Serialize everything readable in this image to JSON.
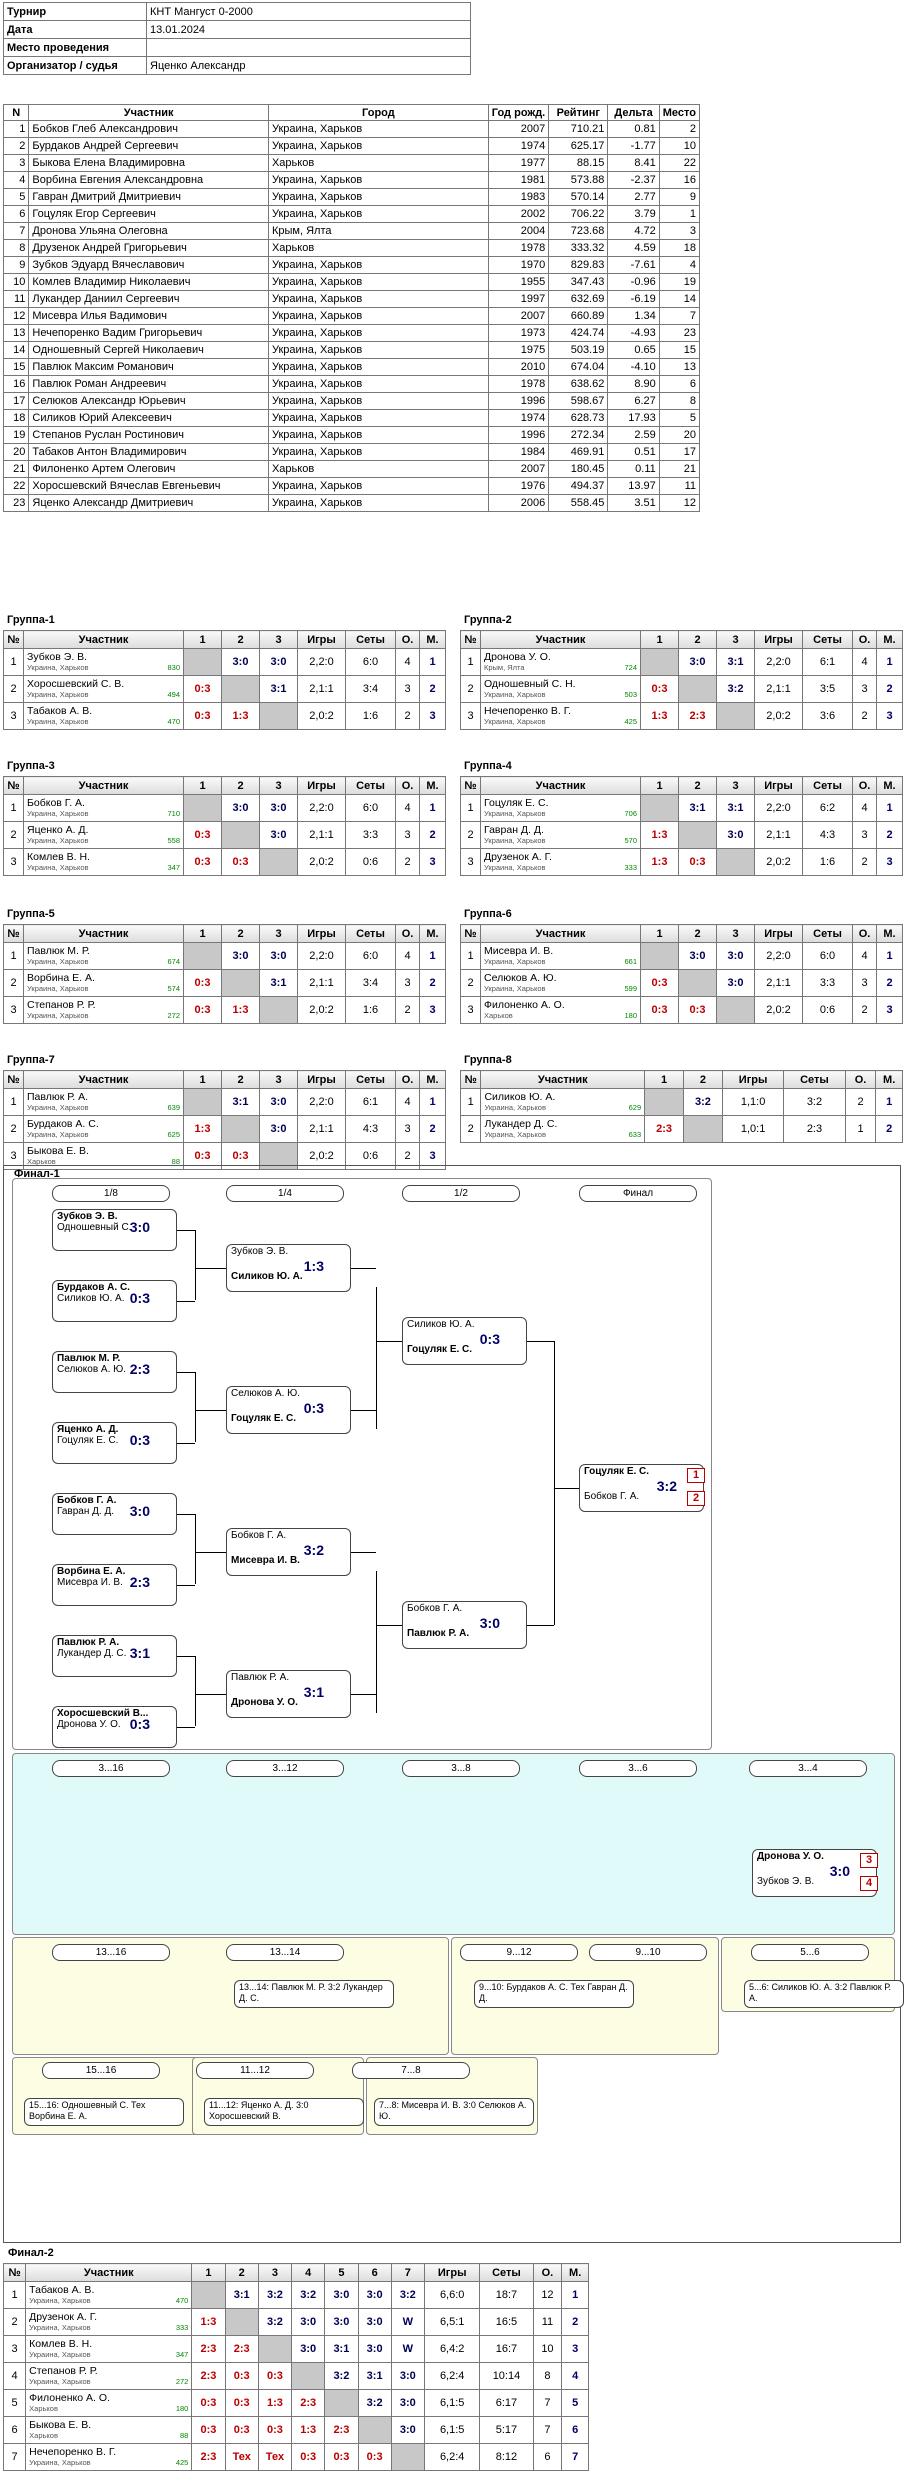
{
  "info": {
    "rows": [
      [
        "Турнир",
        "КНТ Мангуст 0-2000"
      ],
      [
        "Дата",
        "13.01.2024"
      ],
      [
        "Место проведения",
        ""
      ],
      [
        "Организатор / судья",
        "Яценко Александр"
      ]
    ]
  },
  "main": {
    "headers": [
      "N",
      "Участник",
      "Город",
      "Год рожд.",
      "Рейтинг",
      "Дельта",
      "Место"
    ],
    "rows": [
      [
        "1",
        "Бобков Глеб Александрович",
        "Украина, Харьков",
        "2007",
        "710.21",
        "0.81",
        "2"
      ],
      [
        "2",
        "Бурдаков Андрей Сергеевич",
        "Украина, Харьков",
        "1974",
        "625.17",
        "-1.77",
        "10"
      ],
      [
        "3",
        "Быкова Елена Владимировна",
        "Харьков",
        "1977",
        "88.15",
        "8.41",
        "22"
      ],
      [
        "4",
        "Ворбина Евгения Александровна",
        "Украина, Харьков",
        "1981",
        "573.88",
        "-2.37",
        "16"
      ],
      [
        "5",
        "Гавран Дмитрий Дмитриевич",
        "Украина, Харьков",
        "1983",
        "570.14",
        "2.77",
        "9"
      ],
      [
        "6",
        "Гоцуляк Егор Сергеевич",
        "Украина, Харьков",
        "2002",
        "706.22",
        "3.79",
        "1"
      ],
      [
        "7",
        "Дронова Ульяна Олеговна",
        "Крым, Ялта",
        "2004",
        "723.68",
        "4.72",
        "3"
      ],
      [
        "8",
        "Друзенок Андрей Григорьевич",
        "Харьков",
        "1978",
        "333.32",
        "4.59",
        "18"
      ],
      [
        "9",
        "Зубков Эдуард Вячеславович",
        "Украина, Харьков",
        "1970",
        "829.83",
        "-7.61",
        "4"
      ],
      [
        "10",
        "Комлев Владимир Николаевич",
        "Украина, Харьков",
        "1955",
        "347.43",
        "-0.96",
        "19"
      ],
      [
        "11",
        "Лукандер Даниил Сергеевич",
        "Украина, Харьков",
        "1997",
        "632.69",
        "-6.19",
        "14"
      ],
      [
        "12",
        "Мисевра Илья Вадимович",
        "Украина, Харьков",
        "2007",
        "660.89",
        "1.34",
        "7"
      ],
      [
        "13",
        "Нечепоренко Вадим Григорьевич",
        "Украина, Харьков",
        "1973",
        "424.74",
        "-4.93",
        "23"
      ],
      [
        "14",
        "Однoшевный Сергей Николаевич",
        "Украина, Харьков",
        "1975",
        "503.19",
        "0.65",
        "15"
      ],
      [
        "15",
        "Павлюк Максим Романович",
        "Украина, Харьков",
        "2010",
        "674.04",
        "-4.10",
        "13"
      ],
      [
        "16",
        "Павлюк Роман Андреевич",
        "Украина, Харьков",
        "1978",
        "638.62",
        "8.90",
        "6"
      ],
      [
        "17",
        "Селюков Александр Юрьевич",
        "Украина, Харьков",
        "1996",
        "598.67",
        "6.27",
        "8"
      ],
      [
        "18",
        "Силиков Юрий Алексеевич",
        "Украина, Харьков",
        "1974",
        "628.73",
        "17.93",
        "5"
      ],
      [
        "19",
        "Степанов Руслан Ростинович",
        "Украина, Харьков",
        "1996",
        "272.34",
        "2.59",
        "20"
      ],
      [
        "20",
        "Табаков Антон Владимирович",
        "Украина, Харьков",
        "1984",
        "469.91",
        "0.51",
        "17"
      ],
      [
        "21",
        "Филоненко Артем Олегович",
        "Харьков",
        "2007",
        "180.45",
        "0.11",
        "21"
      ],
      [
        "22",
        "Хоросшевский Вячеслав Евгеньевич",
        "Украина, Харьков",
        "1976",
        "494.37",
        "13.97",
        "11"
      ],
      [
        "23",
        "Яценко Александр Дмитриевич",
        "Украина, Харьков",
        "2006",
        "558.45",
        "3.51",
        "12"
      ]
    ]
  },
  "group_headers": [
    "№",
    "Участник",
    "1",
    "2",
    "3",
    "Игры",
    "Сеты",
    "О.",
    "М."
  ],
  "groups": [
    {
      "title": "Группа-1",
      "rows": [
        {
          "n": "1",
          "name": "Зубков Э. В.",
          "city": "Украина, Харьков",
          "rating": "830",
          "s": [
            "",
            "3:0",
            "3:0"
          ],
          "games": "2,2:0",
          "sets": "6:0",
          "pts": "4",
          "pl": "1"
        },
        {
          "n": "2",
          "name": "Хоросшевский С. В.",
          "city": "Украина, Харьков",
          "rating": "494",
          "s": [
            "0:3",
            "",
            "3:1"
          ],
          "games": "2,1:1",
          "sets": "3:4",
          "pts": "3",
          "pl": "2"
        },
        {
          "n": "3",
          "name": "Табаков А. В.",
          "city": "Украина, Харьков",
          "rating": "470",
          "s": [
            "0:3",
            "1:3",
            ""
          ],
          "games": "2,0:2",
          "sets": "1:6",
          "pts": "2",
          "pl": "3"
        }
      ]
    },
    {
      "title": "Группа-2",
      "rows": [
        {
          "n": "1",
          "name": "Дронова У. О.",
          "city": "Крым, Ялта",
          "rating": "724",
          "s": [
            "",
            "3:0",
            "3:1"
          ],
          "games": "2,2:0",
          "sets": "6:1",
          "pts": "4",
          "pl": "1"
        },
        {
          "n": "2",
          "name": "Однoшевный С. Н.",
          "city": "Украина, Харьков",
          "rating": "503",
          "s": [
            "0:3",
            "",
            "3:2"
          ],
          "games": "2,1:1",
          "sets": "3:5",
          "pts": "3",
          "pl": "2"
        },
        {
          "n": "3",
          "name": "Нечепоренко В. Г.",
          "city": "Украина, Харьков",
          "rating": "425",
          "s": [
            "1:3",
            "2:3",
            ""
          ],
          "games": "2,0:2",
          "sets": "3:6",
          "pts": "2",
          "pl": "3"
        }
      ]
    },
    {
      "title": "Группа-3",
      "rows": [
        {
          "n": "1",
          "name": "Бобков Г. А.",
          "city": "Украина, Харьков",
          "rating": "710",
          "s": [
            "",
            "3:0",
            "3:0"
          ],
          "games": "2,2:0",
          "sets": "6:0",
          "pts": "4",
          "pl": "1"
        },
        {
          "n": "2",
          "name": "Яценко А. Д.",
          "city": "Украина, Харьков",
          "rating": "558",
          "s": [
            "0:3",
            "",
            "3:0"
          ],
          "games": "2,1:1",
          "sets": "3:3",
          "pts": "3",
          "pl": "2"
        },
        {
          "n": "3",
          "name": "Комлев В. Н.",
          "city": "Украина, Харьков",
          "rating": "347",
          "s": [
            "0:3",
            "0:3",
            ""
          ],
          "games": "2,0:2",
          "sets": "0:6",
          "pts": "2",
          "pl": "3"
        }
      ]
    },
    {
      "title": "Группа-4",
      "rows": [
        {
          "n": "1",
          "name": "Гоцуляк Е. С.",
          "city": "Украина, Харьков",
          "rating": "706",
          "s": [
            "",
            "3:1",
            "3:1"
          ],
          "games": "2,2:0",
          "sets": "6:2",
          "pts": "4",
          "pl": "1"
        },
        {
          "n": "2",
          "name": "Гавран Д. Д.",
          "city": "Украина, Харьков",
          "rating": "570",
          "s": [
            "1:3",
            "",
            "3:0"
          ],
          "games": "2,1:1",
          "sets": "4:3",
          "pts": "3",
          "pl": "2"
        },
        {
          "n": "3",
          "name": "Друзенок А. Г.",
          "city": "Украина, Харьков",
          "rating": "333",
          "s": [
            "1:3",
            "0:3",
            ""
          ],
          "games": "2,0:2",
          "sets": "1:6",
          "pts": "2",
          "pl": "3"
        }
      ]
    },
    {
      "title": "Группа-5",
      "rows": [
        {
          "n": "1",
          "name": "Павлюк М. Р.",
          "city": "Украина, Харьков",
          "rating": "674",
          "s": [
            "",
            "3:0",
            "3:0"
          ],
          "games": "2,2:0",
          "sets": "6:0",
          "pts": "4",
          "pl": "1"
        },
        {
          "n": "2",
          "name": "Ворбина Е. А.",
          "city": "Украина, Харьков",
          "rating": "574",
          "s": [
            "0:3",
            "",
            "3:1"
          ],
          "games": "2,1:1",
          "sets": "3:4",
          "pts": "3",
          "pl": "2"
        },
        {
          "n": "3",
          "name": "Степанов Р. Р.",
          "city": "Украина, Харьков",
          "rating": "272",
          "s": [
            "0:3",
            "1:3",
            ""
          ],
          "games": "2,0:2",
          "sets": "1:6",
          "pts": "2",
          "pl": "3"
        }
      ]
    },
    {
      "title": "Группа-6",
      "rows": [
        {
          "n": "1",
          "name": "Мисевра И. В.",
          "city": "Украина, Харьков",
          "rating": "661",
          "s": [
            "",
            "3:0",
            "3:0"
          ],
          "games": "2,2:0",
          "sets": "6:0",
          "pts": "4",
          "pl": "1"
        },
        {
          "n": "2",
          "name": "Селюков А. Ю.",
          "city": "Украина, Харьков",
          "rating": "599",
          "s": [
            "0:3",
            "",
            "3:0"
          ],
          "games": "2,1:1",
          "sets": "3:3",
          "pts": "3",
          "pl": "2"
        },
        {
          "n": "3",
          "name": "Филоненко А. О.",
          "city": "Харьков",
          "rating": "180",
          "s": [
            "0:3",
            "0:3",
            ""
          ],
          "games": "2,0:2",
          "sets": "0:6",
          "pts": "2",
          "pl": "3"
        }
      ]
    },
    {
      "title": "Группа-7",
      "rows": [
        {
          "n": "1",
          "name": "Павлюк Р. А.",
          "city": "Украина, Харьков",
          "rating": "639",
          "s": [
            "",
            "3:1",
            "3:0"
          ],
          "games": "2,2:0",
          "sets": "6:1",
          "pts": "4",
          "pl": "1"
        },
        {
          "n": "2",
          "name": "Бурдаков А. С.",
          "city": "Украина, Харьков",
          "rating": "625",
          "s": [
            "1:3",
            "",
            "3:0"
          ],
          "games": "2,1:1",
          "sets": "4:3",
          "pts": "3",
          "pl": "2"
        },
        {
          "n": "3",
          "name": "Быкова Е. В.",
          "city": "Харьков",
          "rating": "88",
          "s": [
            "0:3",
            "0:3",
            ""
          ],
          "games": "2,0:2",
          "sets": "0:6",
          "pts": "2",
          "pl": "3"
        }
      ]
    },
    {
      "title": "Группа-8",
      "short": true,
      "rows": [
        {
          "n": "1",
          "name": "Силиков Ю. А.",
          "city": "Украина, Харьков",
          "rating": "629",
          "s": [
            "",
            "3:2"
          ],
          "games": "1,1:0",
          "sets": "3:2",
          "pts": "2",
          "pl": "1"
        },
        {
          "n": "2",
          "name": "Лукандер Д. С.",
          "city": "Украина, Харьков",
          "rating": "633",
          "s": [
            "2:3",
            ""
          ],
          "games": "1,0:1",
          "sets": "2:3",
          "pts": "1",
          "pl": "2"
        }
      ]
    }
  ],
  "final1": {
    "title": "Финал-1",
    "rounds": [
      "1/8",
      "1/4",
      "1/2",
      "Финал"
    ],
    "cons_rounds": [
      "3...16",
      "3...12",
      "3...8",
      "3...6",
      "3...4"
    ],
    "cons_b": [
      "13...16",
      "13...14",
      "9...12",
      "9...10",
      "5...6"
    ],
    "cons_c": [
      "15...16",
      "11...12",
      "7...8"
    ],
    "champion": "Гоцуляк Е. С.",
    "runnerup": "Бобков Г. А.",
    "final_score": "3:2",
    "third": "Дронова У. О.",
    "fourth": "Зубков Э. В.",
    "third_score": "3:0",
    "sf_left": {
      "w": "Силиков Ю. А.",
      "l": "Гоцуляк Е. С.",
      "s": "0:3"
    },
    "sf_right": {
      "w": "Бобков Г. А.",
      "l": "Павлюк Р. А.",
      "s": "3:0"
    },
    "qf": [
      {
        "a": "Зубков Э. В.",
        "b": "Силиков Ю. А.",
        "s": "1:3"
      },
      {
        "a": "Селюков А. Ю.",
        "b": "Гоцуляк Е. С.",
        "s": "0:3"
      },
      {
        "a": "Бобков Г. А.",
        "b": "Мисевра И. В.",
        "s": "3:2"
      },
      {
        "a": "Павлюк Р. А.",
        "b": "Дронова У. О.",
        "s": "3:1"
      }
    ],
    "r16": [
      {
        "a": "Зубков Э. В.",
        "b": "Однoшевный С.",
        "s": "3:0"
      },
      {
        "a": "Бурдаков А. С.",
        "b": "Силиков Ю. А.",
        "s": "0:3"
      },
      {
        "a": "Павлюк М. Р.",
        "b": "Селюков А. Ю.",
        "s": "2:3"
      },
      {
        "a": "Яценко А. Д.",
        "b": "Гоцуляк Е. С.",
        "s": "0:3"
      },
      {
        "a": "Бобков Г. А.",
        "b": "Гавран Д. Д.",
        "s": "3:0"
      },
      {
        "a": "Ворбина Е. А.",
        "b": "Мисевра И. В.",
        "s": "2:3"
      },
      {
        "a": "Павлюк Р. А.",
        "b": "Лукандер Д. С.",
        "s": "3:1"
      },
      {
        "a": "Хоросшевский В...",
        "b": "Дронова У. О.",
        "s": "0:3"
      }
    ],
    "places": [
      "5...6: Силиков Ю. А. 3:2 Павлюк Р. А.",
      "7...8: Мисевра И. В. 3:0 Селюков А. Ю.",
      "9...10: Бурдаков А. С. Тех Гавран Д. Д.",
      "11...12: Яценко А. Д. 3:0 Хоросшевский В.",
      "13...14: Павлюк М. Р. 3:2 Лукандер Д. С.",
      "15...16: Однoшевный С. Тех Ворбина Е. А."
    ]
  },
  "final2": {
    "title": "Финал-2",
    "headers": [
      "№",
      "Участник",
      "1",
      "2",
      "3",
      "4",
      "5",
      "6",
      "7",
      "Игры",
      "Сеты",
      "О.",
      "М."
    ],
    "rows": [
      {
        "n": "1",
        "name": "Табаков А. В.",
        "city": "Украина, Харьков",
        "rating": "470",
        "s": [
          "",
          "3:1",
          "3:2",
          "3:2",
          "3:0",
          "3:0",
          "3:2"
        ],
        "games": "6,6:0",
        "sets": "18:7",
        "pts": "12",
        "pl": "1"
      },
      {
        "n": "2",
        "name": "Друзенок А. Г.",
        "city": "Украина, Харьков",
        "rating": "333",
        "s": [
          "1:3",
          "",
          "3:2",
          "3:0",
          "3:0",
          "3:0",
          "W"
        ],
        "games": "6,5:1",
        "sets": "16:5",
        "pts": "11",
        "pl": "2"
      },
      {
        "n": "3",
        "name": "Комлев В. Н.",
        "city": "Украина, Харьков",
        "rating": "347",
        "s": [
          "2:3",
          "2:3",
          "",
          "3:0",
          "3:1",
          "3:0",
          "W"
        ],
        "games": "6,4:2",
        "sets": "16:7",
        "pts": "10",
        "pl": "3"
      },
      {
        "n": "4",
        "name": "Степанов Р. Р.",
        "city": "Украина, Харьков",
        "rating": "272",
        "s": [
          "2:3",
          "0:3",
          "0:3",
          "",
          "3:2",
          "3:1",
          "3:0"
        ],
        "games": "6,2:4",
        "sets": "10:14",
        "pts": "8",
        "pl": "4"
      },
      {
        "n": "5",
        "name": "Филоненко А. О.",
        "city": "Харьков",
        "rating": "180",
        "s": [
          "0:3",
          "0:3",
          "1:3",
          "2:3",
          "",
          "3:2",
          "3:0"
        ],
        "games": "6,1:5",
        "sets": "6:17",
        "pts": "7",
        "pl": "5"
      },
      {
        "n": "6",
        "name": "Быкова Е. В.",
        "city": "Харьков",
        "rating": "88",
        "s": [
          "0:3",
          "0:3",
          "0:3",
          "1:3",
          "2:3",
          "",
          "3:0"
        ],
        "games": "6,1:5",
        "sets": "5:17",
        "pts": "7",
        "pl": "6"
      },
      {
        "n": "7",
        "name": "Нечепоренко В. Г.",
        "city": "Украина, Харьков",
        "rating": "425",
        "s": [
          "2:3",
          "Тех",
          "Тех",
          "0:3",
          "0:3",
          "0:3",
          ""
        ],
        "games": "6,2:4",
        "sets": "8:12",
        "pts": "6",
        "pl": "7"
      }
    ]
  }
}
